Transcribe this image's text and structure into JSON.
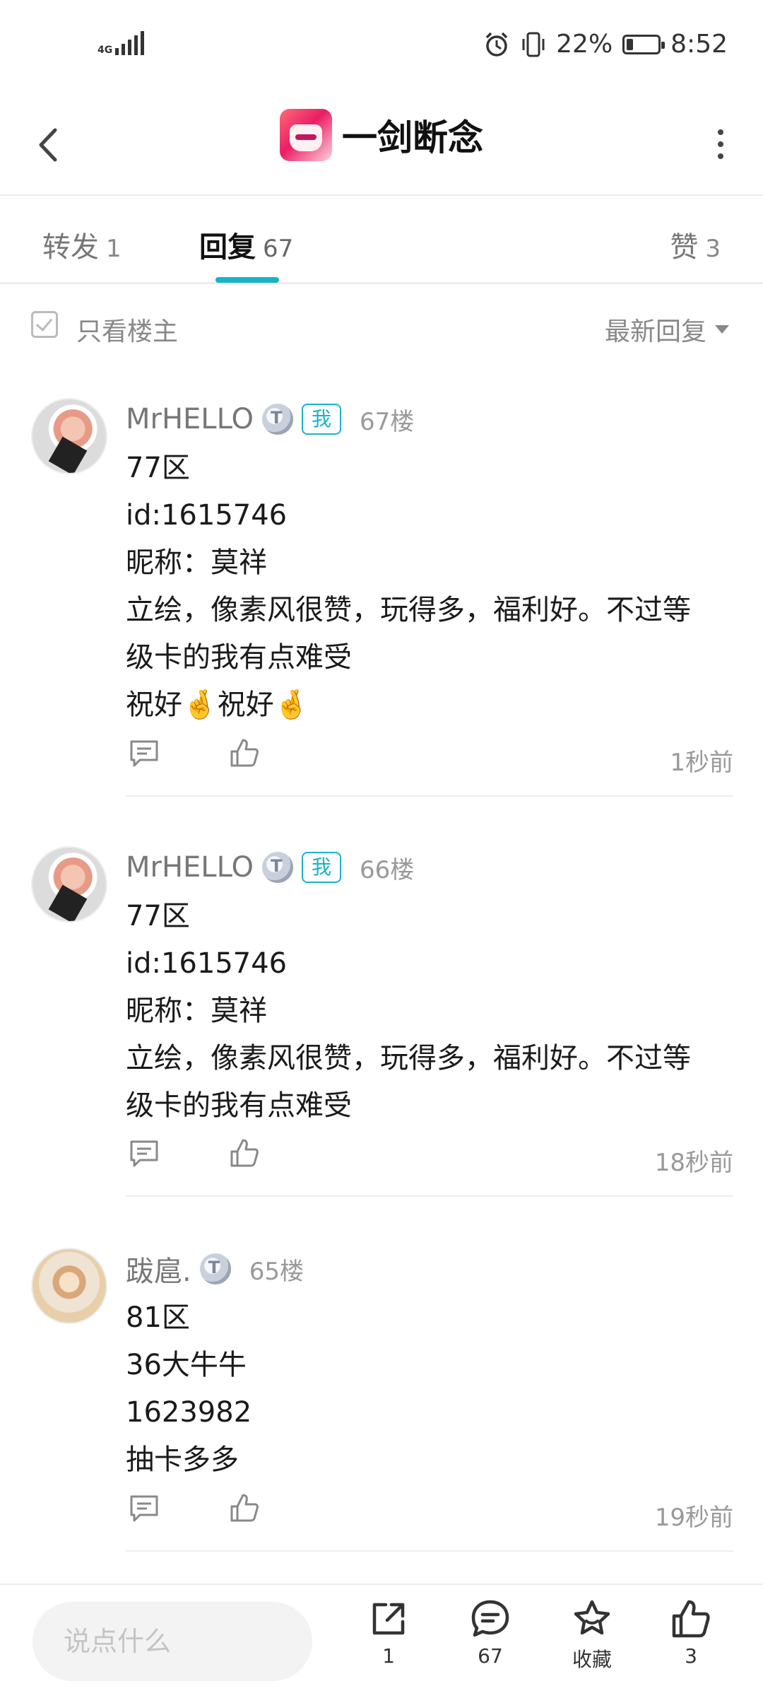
{
  "status_bar": {
    "network": "4G",
    "battery": "22%",
    "battery_fraction": 0.22,
    "time": "8:52"
  },
  "header": {
    "title": "一剑断念",
    "logo_icon": "game-app-icon"
  },
  "tabs": [
    {
      "label": "转发",
      "count": "1"
    },
    {
      "label": "回复",
      "count": "67",
      "active": true
    },
    {
      "label": "赞",
      "count": "3"
    }
  ],
  "filter": {
    "only_op_label": "只看楼主",
    "sort_label": "最新回复"
  },
  "posts": [
    {
      "username": "MrHELLO",
      "me_badge": "我",
      "floor": "67楼",
      "lines": [
        "77区",
        "id:1615746",
        "昵称：莫祥",
        "立绘，像素风很赞，玩得多，福利好。不过等",
        "级卡的我有点难受",
        "祝好🤞祝好🤞"
      ],
      "time": "1秒前"
    },
    {
      "username": "MrHELLO",
      "me_badge": "我",
      "floor": "66楼",
      "lines": [
        "77区",
        "id:1615746",
        "昵称：莫祥",
        "立绘，像素风很赞，玩得多，福利好。不过等",
        "级卡的我有点难受"
      ],
      "time": "18秒前"
    },
    {
      "username": "跋扈.",
      "floor": "65楼",
      "lines": [
        "81区",
        "36大牛牛",
        "1623982",
        "抽卡多多"
      ],
      "time": "19秒前"
    }
  ],
  "bottom_bar": {
    "input_placeholder": "说点什么",
    "share_count": "1",
    "comment_count": "67",
    "favorite_label": "收藏",
    "like_count": "3"
  },
  "colors": {
    "accent": "#19b3c6"
  }
}
